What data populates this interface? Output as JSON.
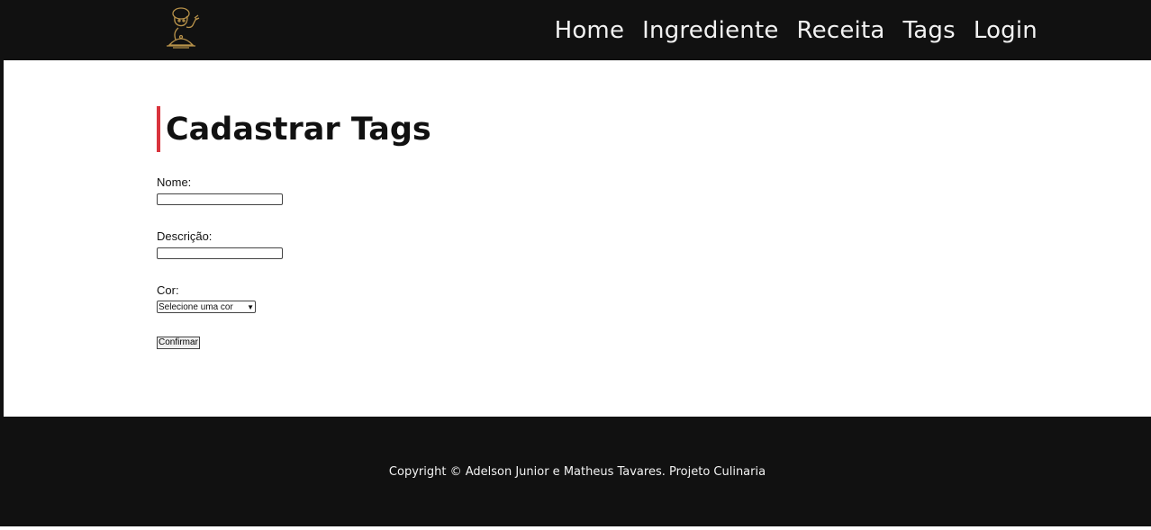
{
  "nav": {
    "logo_icon": "chef-logo-icon",
    "links": [
      "Home",
      "Ingrediente",
      "Receita",
      "Tags",
      "Login"
    ]
  },
  "main": {
    "title": "Cadastrar Tags",
    "form": {
      "nome_label": "Nome:",
      "nome_value": "",
      "descricao_label": "Descrição:",
      "descricao_value": "",
      "cor_label": "Cor:",
      "cor_selected": "Selecione uma cor",
      "confirm_label": "Confirmar"
    }
  },
  "footer": {
    "copyright": "Copyright © Adelson Junior e Matheus Tavares. Projeto Culinaria"
  },
  "colors": {
    "nav_bg": "#111111",
    "accent": "#d9343d",
    "logo_gold": "#b8924a"
  }
}
